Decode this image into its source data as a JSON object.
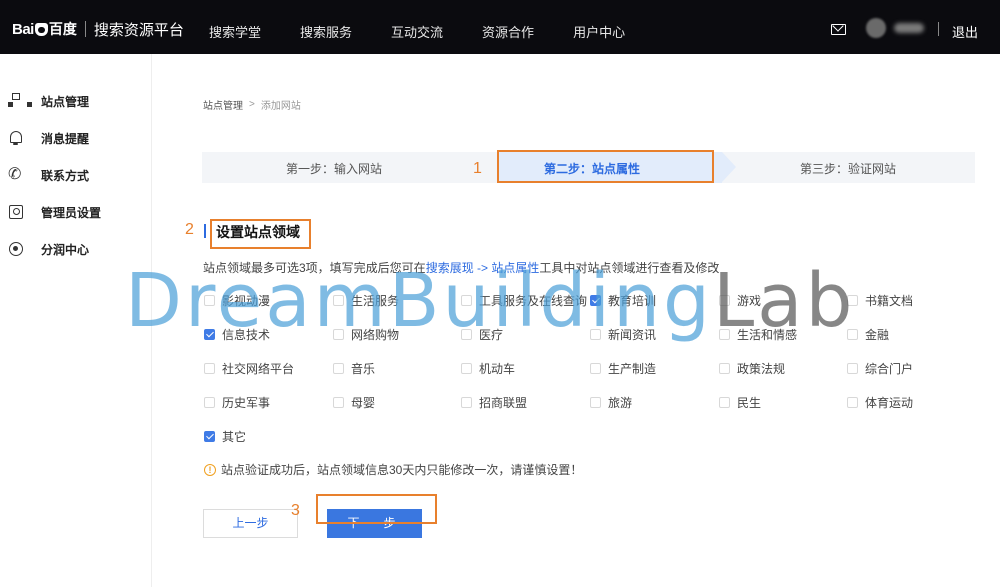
{
  "header": {
    "logo_text": "Bai",
    "logo_cn": "百度",
    "platform": "搜索资源平台",
    "nav": [
      "搜索学堂",
      "搜索服务",
      "互动交流",
      "资源合作",
      "用户中心"
    ],
    "logout": "退出"
  },
  "sidebar": {
    "items": [
      {
        "label": "站点管理",
        "icon": "sitemap-icon"
      },
      {
        "label": "消息提醒",
        "icon": "bell-icon"
      },
      {
        "label": "联系方式",
        "icon": "phone-icon"
      },
      {
        "label": "管理员设置",
        "icon": "admin-icon"
      },
      {
        "label": "分润中心",
        "icon": "share-icon"
      }
    ]
  },
  "breadcrumb": {
    "root": "站点管理",
    "separator": ">",
    "current": "添加网站"
  },
  "steps": {
    "step1": "第一步：输入网站",
    "step2": "第二步：站点属性",
    "step3": "第三步：验证网站"
  },
  "annotations": {
    "a1": "1",
    "a2": "2",
    "a3": "3"
  },
  "section": {
    "title": "设置站点领域",
    "desc_pre": "站点领域最多可选3项，填写完成后您可在",
    "desc_link": "搜索展现 -> 站点属性",
    "desc_post": "工具中对站点领域进行查看及修改"
  },
  "domains": [
    {
      "label": "影视动漫",
      "checked": false
    },
    {
      "label": "生活服务",
      "checked": false
    },
    {
      "label": "工具服务及在线查询",
      "checked": false
    },
    {
      "label": "教育培训",
      "checked": true
    },
    {
      "label": "游戏",
      "checked": false
    },
    {
      "label": "书籍文档",
      "checked": false
    },
    {
      "label": "信息技术",
      "checked": true
    },
    {
      "label": "网络购物",
      "checked": false
    },
    {
      "label": "医疗",
      "checked": false
    },
    {
      "label": "新闻资讯",
      "checked": false
    },
    {
      "label": "生活和情感",
      "checked": false
    },
    {
      "label": "金融",
      "checked": false
    },
    {
      "label": "社交网络平台",
      "checked": false
    },
    {
      "label": "音乐",
      "checked": false
    },
    {
      "label": "机动车",
      "checked": false
    },
    {
      "label": "生产制造",
      "checked": false
    },
    {
      "label": "政策法规",
      "checked": false
    },
    {
      "label": "综合门户",
      "checked": false
    },
    {
      "label": "历史军事",
      "checked": false
    },
    {
      "label": "母婴",
      "checked": false
    },
    {
      "label": "招商联盟",
      "checked": false
    },
    {
      "label": "旅游",
      "checked": false
    },
    {
      "label": "民生",
      "checked": false
    },
    {
      "label": "体育运动",
      "checked": false
    },
    {
      "label": "其它",
      "checked": true
    }
  ],
  "tip": "站点验证成功后，站点领域信息30天内只能修改一次，请谨慎设置！",
  "buttons": {
    "prev": "上一步",
    "next": "下一步"
  },
  "watermark": {
    "part1": "Dream",
    "part2": "Building",
    "part3": "Lab"
  },
  "colors": {
    "accent": "#2d6be0",
    "annotation": "#e8802d",
    "topbar": "#0b0b0f"
  }
}
